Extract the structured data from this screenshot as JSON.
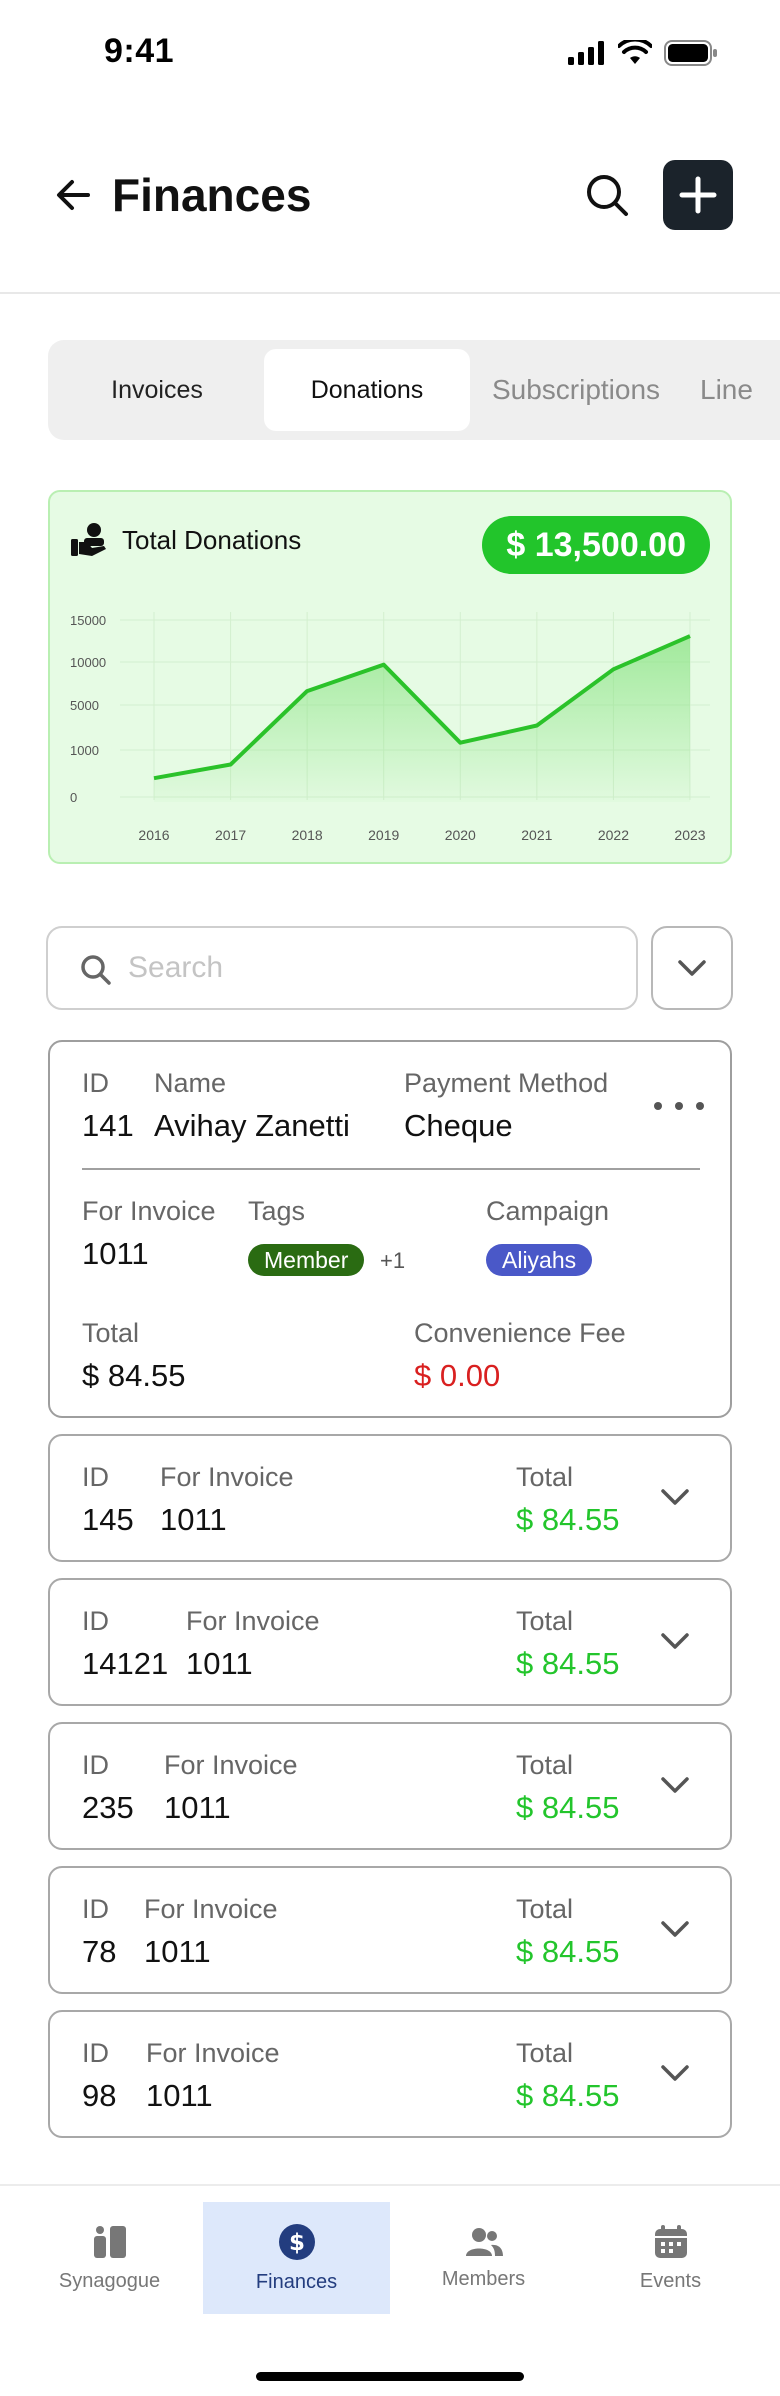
{
  "status": {
    "time": "9:41"
  },
  "header": {
    "title": "Finances"
  },
  "tabs": [
    {
      "label": "Invoices",
      "active": false
    },
    {
      "label": "Donations",
      "active": true
    },
    {
      "label": "Subscriptions",
      "active": false
    },
    {
      "label": "Line",
      "active": false
    }
  ],
  "summary": {
    "title": "Total Donations",
    "total": "$ 13,500.00"
  },
  "chart_data": {
    "type": "area",
    "x": [
      "2016",
      "2017",
      "2018",
      "2019",
      "2020",
      "2021",
      "2022",
      "2023"
    ],
    "ytick_labels": [
      "15000",
      "10000",
      "5000",
      "1000",
      "0"
    ],
    "values": [
      1200,
      2400,
      8800,
      11100,
      4300,
      5800,
      10700,
      13600
    ],
    "ylim": [
      0,
      15000
    ],
    "grid": true,
    "line_color": "#2bc22a",
    "fill_color": "#8ae383"
  },
  "search": {
    "placeholder": "Search",
    "value": ""
  },
  "expanded_card": {
    "id_label": "ID",
    "id": "141",
    "name_label": "Name",
    "name": "Avihay Zanetti",
    "method_label": "Payment Method",
    "method": "Cheque",
    "invoice_label": "For Invoice",
    "invoice": "1011",
    "tags_label": "Tags",
    "tag": "Member",
    "tag_extra": "+1",
    "campaign_label": "Campaign",
    "campaign": "Aliyahs",
    "total_label": "Total",
    "total": "$ 84.55",
    "fee_label": "Convenience Fee",
    "fee": "$ 0.00"
  },
  "rows": [
    {
      "id_label": "ID",
      "id": "145",
      "invoice_label": "For Invoice",
      "invoice": "1011",
      "total_label": "Total",
      "total": "$ 84.55"
    },
    {
      "id_label": "ID",
      "id": "14121",
      "invoice_label": "For Invoice",
      "invoice": "1011",
      "total_label": "Total",
      "total": "$ 84.55"
    },
    {
      "id_label": "ID",
      "id": "235",
      "invoice_label": "For Invoice",
      "invoice": "1011",
      "total_label": "Total",
      "total": "$ 84.55"
    },
    {
      "id_label": "ID",
      "id": "78",
      "invoice_label": "For Invoice",
      "invoice": "1011",
      "total_label": "Total",
      "total": "$ 84.55"
    },
    {
      "id_label": "ID",
      "id": "98",
      "invoice_label": "For Invoice",
      "invoice": "1011",
      "total_label": "Total",
      "total": "$ 84.55"
    }
  ],
  "nav": [
    {
      "label": "Synagogue",
      "icon": "synagogue-icon",
      "active": false
    },
    {
      "label": "Finances",
      "icon": "dollar-circle-icon",
      "active": true
    },
    {
      "label": "Members",
      "icon": "members-icon",
      "active": false
    },
    {
      "label": "Events",
      "icon": "calendar-icon",
      "active": false
    }
  ],
  "colors": {
    "accent_green": "#22c52b",
    "danger_red": "#d92020",
    "nav_active_bg": "#dde8fb",
    "nav_active_text": "#233d7f"
  }
}
